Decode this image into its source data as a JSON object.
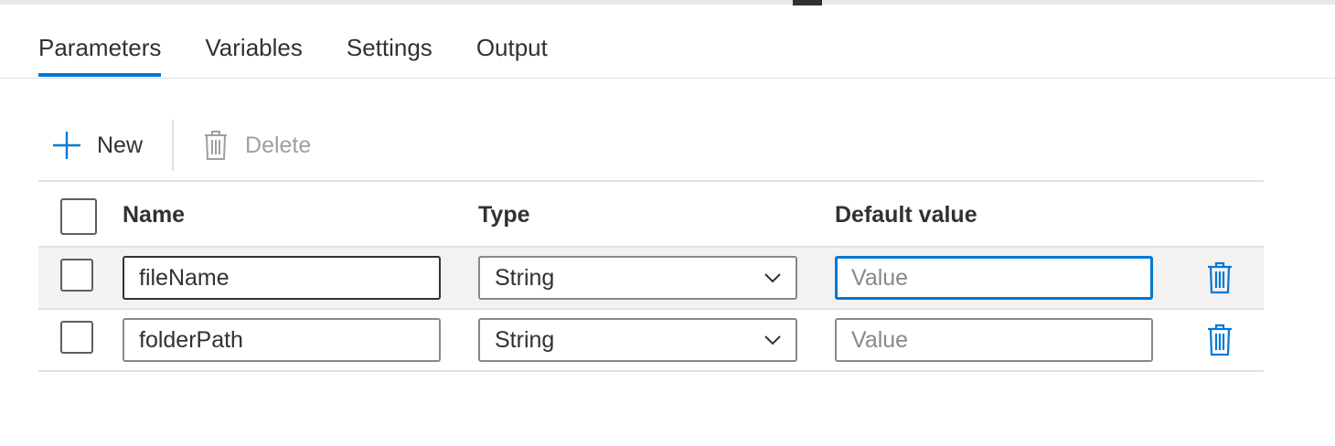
{
  "tabs": [
    {
      "label": "Parameters",
      "active": true
    },
    {
      "label": "Variables",
      "active": false
    },
    {
      "label": "Settings",
      "active": false
    },
    {
      "label": "Output",
      "active": false
    }
  ],
  "toolbar": {
    "new_label": "New",
    "new_icon": "plus-icon",
    "delete_label": "Delete",
    "delete_icon": "trash-icon",
    "delete_enabled": false
  },
  "table": {
    "columns": [
      "Name",
      "Type",
      "Default value"
    ],
    "rows": [
      {
        "name": "fileName",
        "type": "String",
        "default_value": "",
        "default_placeholder": "Value",
        "selected": true
      },
      {
        "name": "folderPath",
        "type": "String",
        "default_value": "",
        "default_placeholder": "Value",
        "selected": false
      }
    ],
    "row_delete_icon": "trash-icon"
  },
  "colors": {
    "accent": "#0078d4",
    "text": "#323130",
    "disabled_text": "#a19f9d",
    "selected_row_bg": "#f3f2f1"
  }
}
